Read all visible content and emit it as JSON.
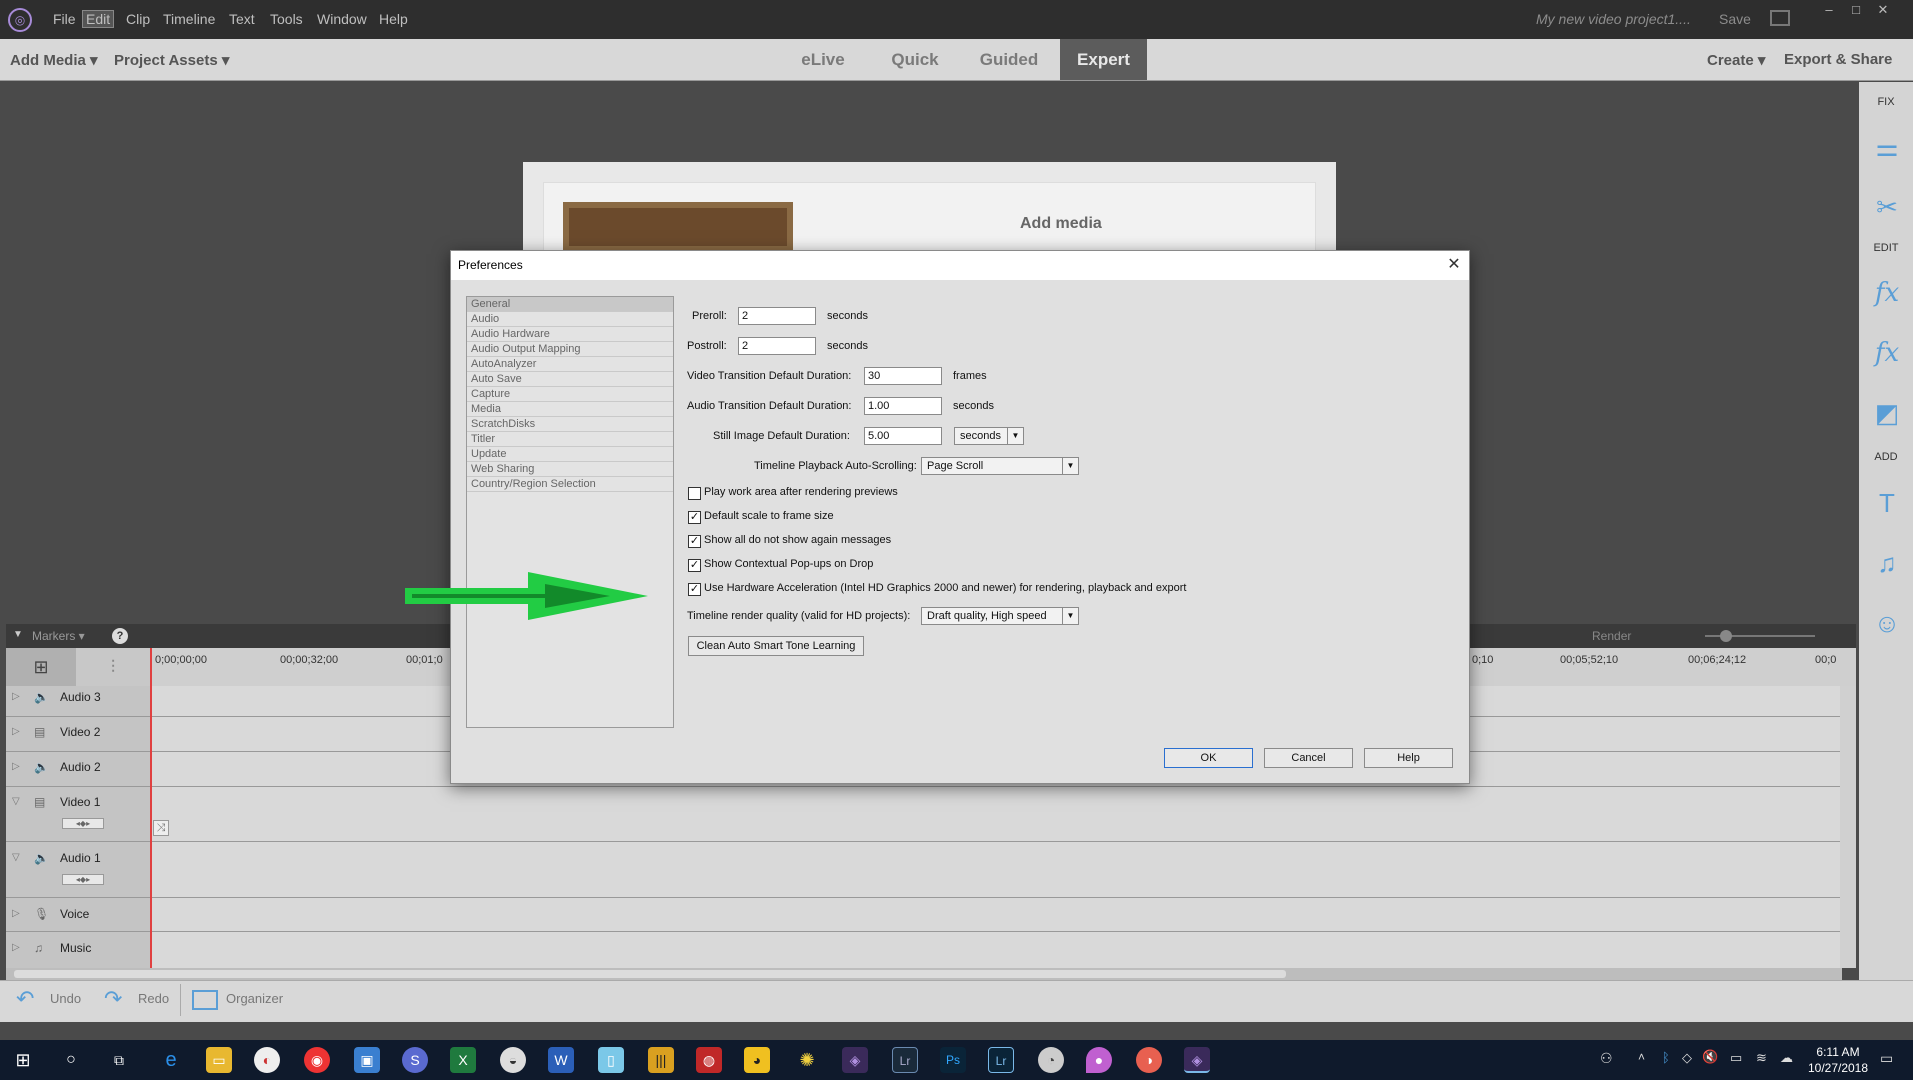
{
  "menu": [
    "File",
    "Edit",
    "Clip",
    "Timeline",
    "Text",
    "Tools",
    "Window",
    "Help"
  ],
  "project_title": "My new video project1....",
  "save_label": "Save",
  "modebar": {
    "add_media": "Add Media",
    "project_assets": "Project Assets",
    "tabs": [
      "eLive",
      "Quick",
      "Guided",
      "Expert"
    ],
    "active_tab": "Expert",
    "create": "Create",
    "export_share": "Export & Share"
  },
  "right_panel": {
    "fix": "FIX",
    "edit": "EDIT",
    "add": "ADD"
  },
  "monitor": {
    "add_media_label": "Add media"
  },
  "timeline": {
    "markers_label": "Markers",
    "render_label": "Render",
    "ruler": [
      "0;00;00;00",
      "00;00;32;00",
      "00;01;0",
      "0;10",
      "00;05;52;10",
      "00;06;24;12",
      "00;0"
    ],
    "tracks": [
      "Audio 3",
      "Video 2",
      "Audio 2",
      "Video 1",
      "Audio 1",
      "Voice",
      "Music"
    ]
  },
  "bottom": {
    "undo": "Undo",
    "redo": "Redo",
    "organizer": "Organizer"
  },
  "dialog": {
    "title": "Preferences",
    "categories": [
      "General",
      "Audio",
      "Audio Hardware",
      "Audio Output Mapping",
      "AutoAnalyzer",
      "Auto Save",
      "Capture",
      "Media",
      "ScratchDisks",
      "Titler",
      "Update",
      "Web Sharing",
      "Country/Region Selection"
    ],
    "selected_category": "General",
    "preroll_label": "Preroll:",
    "preroll_value": "2",
    "preroll_unit": "seconds",
    "postroll_label": "Postroll:",
    "postroll_value": "2",
    "postroll_unit": "seconds",
    "vtrans_label": "Video Transition Default Duration:",
    "vtrans_value": "30",
    "vtrans_unit": "frames",
    "atrans_label": "Audio Transition Default Duration:",
    "atrans_value": "1.00",
    "atrans_unit": "seconds",
    "still_label": "Still Image Default Duration:",
    "still_value": "5.00",
    "still_unit": "seconds",
    "autoscroll_label": "Timeline Playback Auto-Scrolling:",
    "autoscroll_value": "Page Scroll",
    "checkboxes": [
      {
        "label": "Play work area after rendering previews",
        "checked": false
      },
      {
        "label": "Default scale to frame size",
        "checked": true
      },
      {
        "label": "Show all do not show again messages",
        "checked": true
      },
      {
        "label": "Show Contextual Pop-ups on Drop",
        "checked": true
      },
      {
        "label": "Use Hardware Acceleration (Intel HD Graphics 2000 and newer) for rendering, playback and export",
        "checked": true
      }
    ],
    "render_quality_label": "Timeline render quality (valid for HD projects):",
    "render_quality_value": "Draft quality, High speed",
    "clean_button": "Clean Auto Smart Tone Learning",
    "ok": "OK",
    "cancel": "Cancel",
    "help": "Help"
  },
  "clock": {
    "time": "6:11 AM",
    "date": "10/27/2018"
  },
  "colors": {
    "accent_arrow": "#22cc44",
    "expert_tab": "#5c5c5c",
    "playhead": "#e04040"
  }
}
